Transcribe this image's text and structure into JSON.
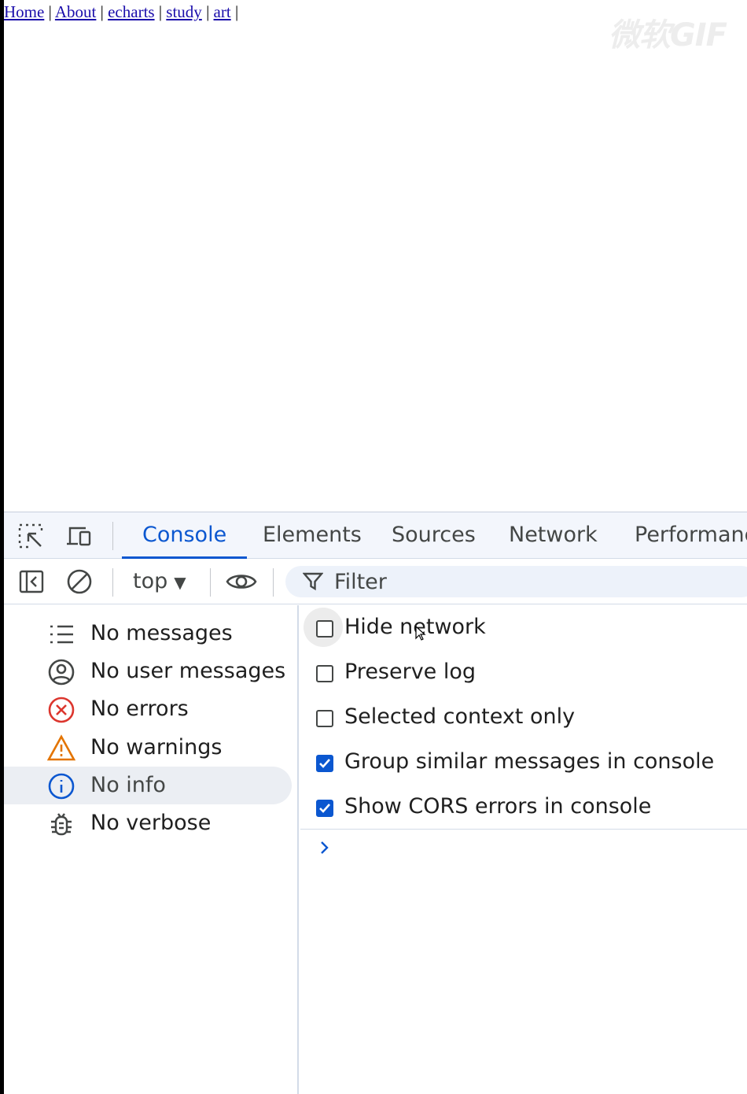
{
  "page": {
    "nav_links": [
      "Home",
      "About",
      "echarts",
      "study",
      "art"
    ],
    "separator": "|",
    "watermark": "微软GIF"
  },
  "devtools": {
    "tabs": [
      {
        "label": "Console",
        "active": true
      },
      {
        "label": "Elements",
        "active": false
      },
      {
        "label": "Sources",
        "active": false
      },
      {
        "label": "Network",
        "active": false
      },
      {
        "label": "Performanc",
        "active": false
      }
    ],
    "toolbar": {
      "context": "top",
      "filter_placeholder": "Filter"
    },
    "sidebar": [
      {
        "label": "No messages",
        "icon": "list-icon"
      },
      {
        "label": "No user messages",
        "icon": "user-icon"
      },
      {
        "label": "No errors",
        "icon": "error-icon"
      },
      {
        "label": "No warnings",
        "icon": "warning-icon"
      },
      {
        "label": "No info",
        "icon": "info-icon",
        "selected": true
      },
      {
        "label": "No verbose",
        "icon": "bug-icon"
      }
    ],
    "settings": [
      {
        "label": "Hide network",
        "checked": false
      },
      {
        "label": "Preserve log",
        "checked": false
      },
      {
        "label": "Selected context only",
        "checked": false
      },
      {
        "label": "Group similar messages in console",
        "checked": true
      },
      {
        "label": "Show CORS errors in console",
        "checked": true
      }
    ],
    "colors": {
      "accent": "#0b57d0",
      "error": "#dc362e",
      "warning": "#e37400"
    }
  }
}
